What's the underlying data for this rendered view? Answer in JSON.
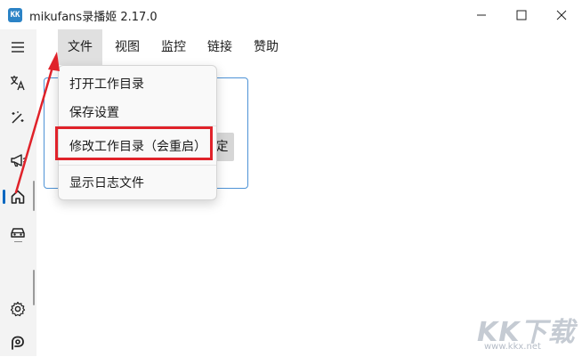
{
  "window": {
    "icon_text": "KK",
    "title": "mikufans录播姬 2.17.0"
  },
  "menubar": {
    "items": [
      "文件",
      "视图",
      "监控",
      "链接",
      "赞助"
    ],
    "active_index": 0
  },
  "file_menu": {
    "items": [
      "打开工作目录",
      "保存设置",
      "修改工作目录（会重启）",
      "显示日志文件"
    ],
    "highlighted_index": 2
  },
  "content": {
    "card_button_text": "定"
  },
  "sidebar": {
    "icons": [
      "menu-icon",
      "translate-icon",
      "magic-wand-icon",
      "megaphone-icon",
      "home-icon",
      "car-icon",
      "gear-icon",
      "p-logo-icon"
    ],
    "selected": "home-icon"
  },
  "watermark": {
    "big": "KK下载",
    "small": "www.kkx.net"
  },
  "colors": {
    "accent": "#0067c0",
    "annotation": "#e0222a"
  }
}
